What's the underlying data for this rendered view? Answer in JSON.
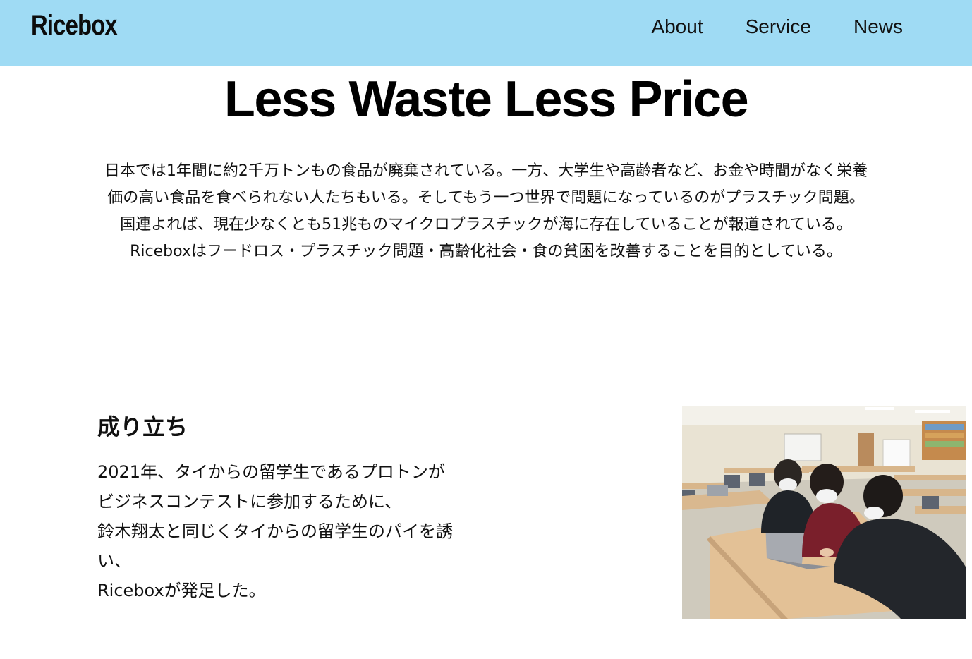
{
  "header": {
    "logo": "Ricebox",
    "nav": [
      {
        "label": "About"
      },
      {
        "label": "Service"
      },
      {
        "label": "News"
      }
    ]
  },
  "hero": {
    "title": "Less Waste Less Price"
  },
  "intro": {
    "lines": [
      "日本では1年間に約2千万トンもの食品が廃棄されている。一方、大学生や高齢者など、お金や時間がなく栄養",
      "価の高い食品を食べられない人たちもいる。そしてもう一つ世界で問題になっているのがプラスチック問題。",
      "国連よれば、現在少なくとも51兆ものマイクロプラスチックが海に存在していることが報道されている。",
      "Riceboxはフードロス・プラスチック問題・高齢化社会・食の貧困を改善することを目的としている。"
    ]
  },
  "origin": {
    "title": "成り立ち",
    "lines": [
      "2021年、タイからの留学生であるプロトンが",
      "ビジネスコンテストに参加するために、",
      "鈴木翔太と同じくタイからの留学生のパイを誘",
      "い、",
      "Riceboxが発足した。"
    ],
    "photo_icon": "photo-students-at-laptop-icon"
  }
}
